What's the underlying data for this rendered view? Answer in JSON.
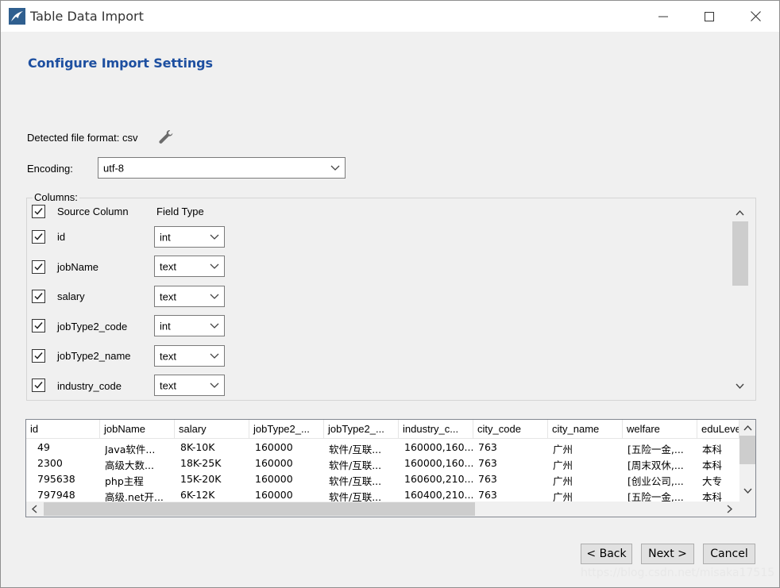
{
  "window": {
    "title": "Table Data Import",
    "controls": [
      "minimize",
      "maximize",
      "close"
    ]
  },
  "page": {
    "heading": "Configure Import Settings"
  },
  "file_format": {
    "label": "Detected file format: csv",
    "icon": "wrench-icon"
  },
  "encoding": {
    "label": "Encoding:",
    "value": "utf-8"
  },
  "columns": {
    "legend": "Columns:",
    "header": {
      "source": "Source Column",
      "type": "Field Type",
      "checked": true
    },
    "rows": [
      {
        "name": "id",
        "type": "int",
        "checked": true
      },
      {
        "name": "jobName",
        "type": "text",
        "checked": true
      },
      {
        "name": "salary",
        "type": "text",
        "checked": true
      },
      {
        "name": "jobType2_code",
        "type": "int",
        "checked": true
      },
      {
        "name": "jobType2_name",
        "type": "text",
        "checked": true
      },
      {
        "name": "industry_code",
        "type": "text",
        "checked": true
      }
    ]
  },
  "preview": {
    "headers": [
      "id",
      "jobName",
      "salary",
      "jobType2_...",
      "jobType2_...",
      "industry_c...",
      "city_code",
      "city_name",
      "welfare",
      "eduLeve"
    ],
    "rows": [
      [
        "49",
        "Java软件...",
        "8K-10K",
        "160000",
        "软件/互联...",
        "160000,160...",
        "763",
        "广州",
        "[五险一金,...",
        "本科"
      ],
      [
        "2300",
        "高级大数...",
        "18K-25K",
        "160000",
        "软件/互联...",
        "160000,160...",
        "763",
        "广州",
        "[周末双休,...",
        "本科"
      ],
      [
        "795638",
        "php主程",
        "15K-20K",
        "160000",
        "软件/互联...",
        "160600,210...",
        "763",
        "广州",
        "[创业公司,...",
        "大专"
      ],
      [
        "797948",
        "高级.net开...",
        "6K-12K",
        "160000",
        "软件/互联...",
        "160400,210...",
        "763",
        "广州",
        "[五险一金,...",
        "本科"
      ]
    ]
  },
  "buttons": {
    "back": "< Back",
    "next": "Next >",
    "cancel": "Cancel"
  },
  "watermark": "https://blog.csdn.net/misaka17515",
  "colors": {
    "heading": "#1d4fa0",
    "window_bg": "#f0f0f0",
    "titlebar_bg": "#ffffff"
  }
}
